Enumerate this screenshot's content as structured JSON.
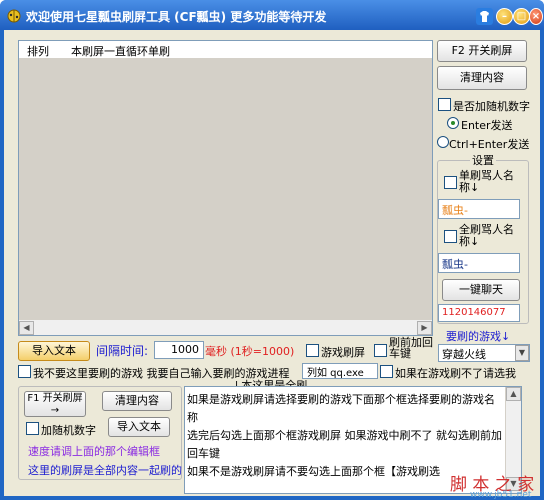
{
  "window": {
    "title": "欢迎使用七星瓢虫刷屏工具 (CF瓢虫) 更多功能等待开发",
    "title_bar_buttons": [
      "skin-icon",
      "minimize-icon",
      "maximize-icon",
      "close-icon"
    ]
  },
  "list": {
    "columns": [
      "排列",
      "本刷屏一直循环单刷"
    ]
  },
  "right_panel": {
    "toggle_button": "F2  开关刷屏",
    "clear_button": "清理内容",
    "random_number_label": "是否加随机数字",
    "enter_send_label": "Enter发送",
    "ctrl_enter_send_label": "Ctrl+Enter发送",
    "settings_title": "设置",
    "single_name_label": "单刷骂人名称↓",
    "single_name_value": "瓢虫-",
    "all_name_label": "全刷骂人名称↓",
    "all_name_value": "瓢虫-",
    "chat_button": "一键聊天",
    "qq_value": "1120146077",
    "game_label": "要刷的游戏↓",
    "game_value": "穿越火线"
  },
  "middle_row": {
    "import_button": "导入文本",
    "interval_label": "间隔时间:",
    "interval_value": "1000",
    "interval_unit": "毫秒 (1秒=1000)",
    "game_refresh_label": "游戏刷屏",
    "enter_before_label": "刷前加回车键",
    "no_game_label": "我不要这里要刷的游戏 我要自己输入要刷的游戏进程",
    "process_value": "列如  qq.exe",
    "game_no_label": "如果在游戏刷不了请选我",
    "all_refresh_title": "↓本这里是全刷"
  },
  "bottom_left": {
    "f1_button": "F1 开关刷屏 →",
    "clear_button": "清理内容",
    "random_label": "加随机数字",
    "import_button": "导入文本",
    "speed_hint": "速度请调上面的那个编辑框",
    "content_hint": "这里的刷屏是全部内容一起刷的"
  },
  "editor": {
    "text": "如果是游戏刷屏请选择要刷的游戏下面那个框选择要刷的游戏名称\n选完后勾选上面那个框游戏刷屏 如果游戏中刷不了 就勾选刷前加回车键\n如果不是游戏刷屏请不要勾选上面那个框【游戏刷选"
  },
  "watermark": {
    "text": "脚 本 之 家",
    "url": "www.jb51.net"
  },
  "colors": {
    "title_bar": "#1f5fc0",
    "client_bg": "#ece9d8",
    "accent_blue": "#2020d0",
    "accent_red": "#e02020",
    "accent_purple": "#8a2be2"
  }
}
